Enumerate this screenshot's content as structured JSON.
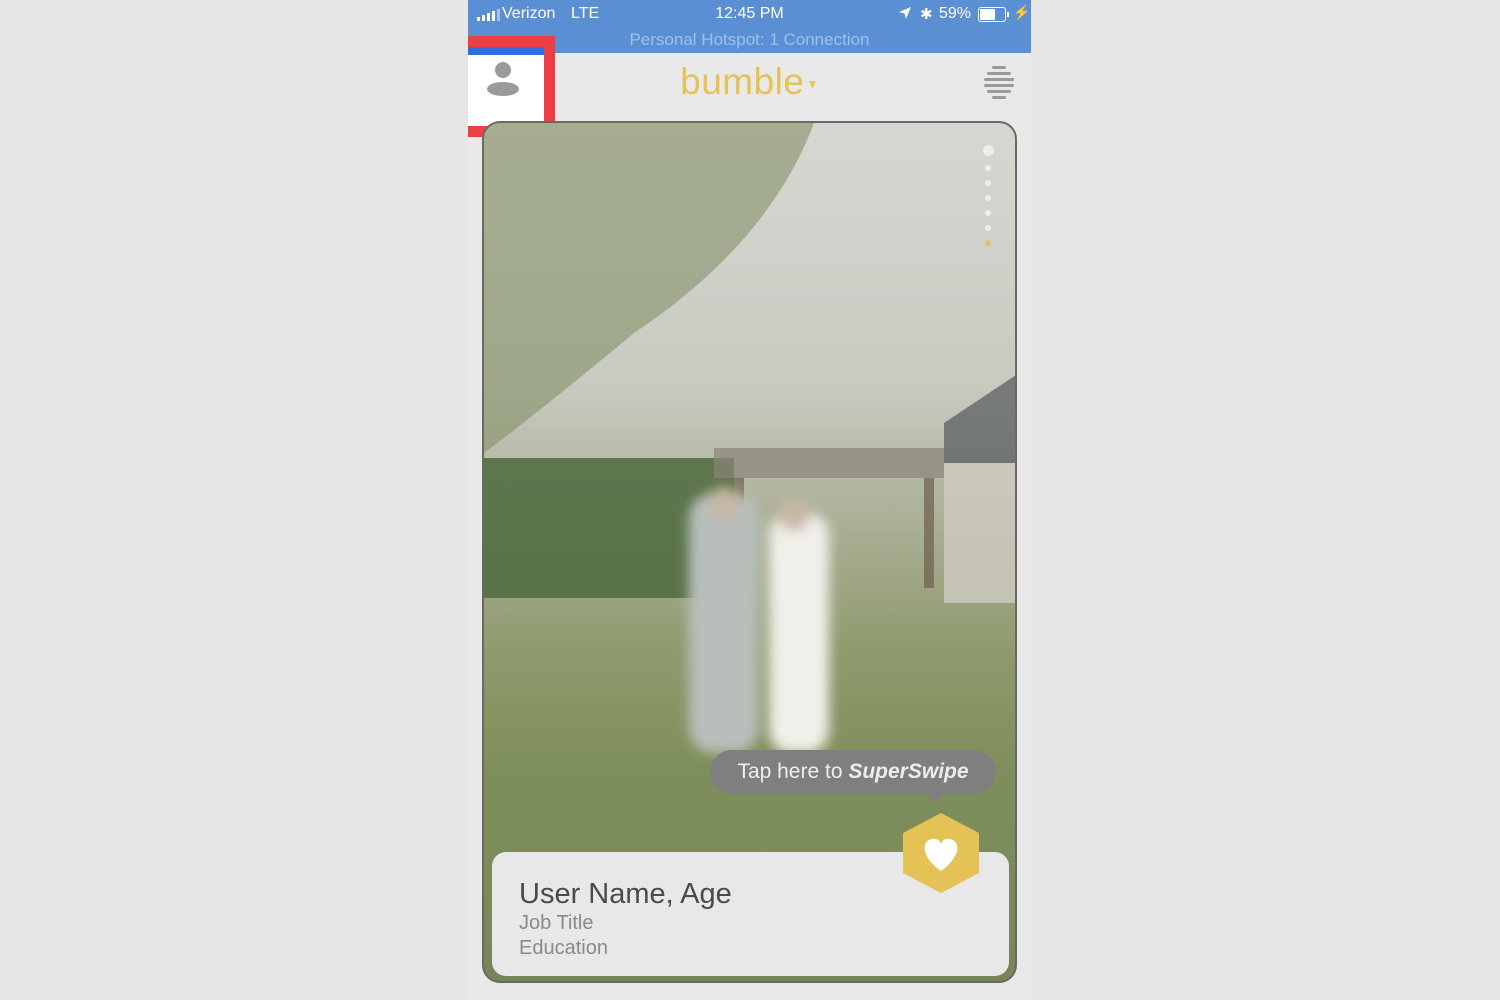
{
  "status_bar": {
    "carrier": "Verizon",
    "network": "LTE",
    "time": "12:45 PM",
    "battery": "59%",
    "battery_level": 0.59,
    "hotspot": "Personal Hotspot: 1 Connection",
    "icons": [
      "signal-icon",
      "location-arrow-icon",
      "bluetooth-icon",
      "battery-icon",
      "charging-bolt-icon"
    ]
  },
  "header": {
    "brand": "bumble",
    "brand_color": "#e5c255",
    "profile_icon": "avatar-icon",
    "menu_icon": "hive-menu-icon"
  },
  "card": {
    "photo_pagination": {
      "count": 7,
      "active_index": 6,
      "active_color": "#e5c255"
    },
    "superswipe_tip_prefix": "Tap here to ",
    "superswipe_tip_brand": "SuperSwipe",
    "user_name": "User Name, Age",
    "job_title": "Job Title",
    "education": "Education",
    "superswipe_icon": "heart-hexagon-icon"
  },
  "highlight_color": "#ec3f45"
}
